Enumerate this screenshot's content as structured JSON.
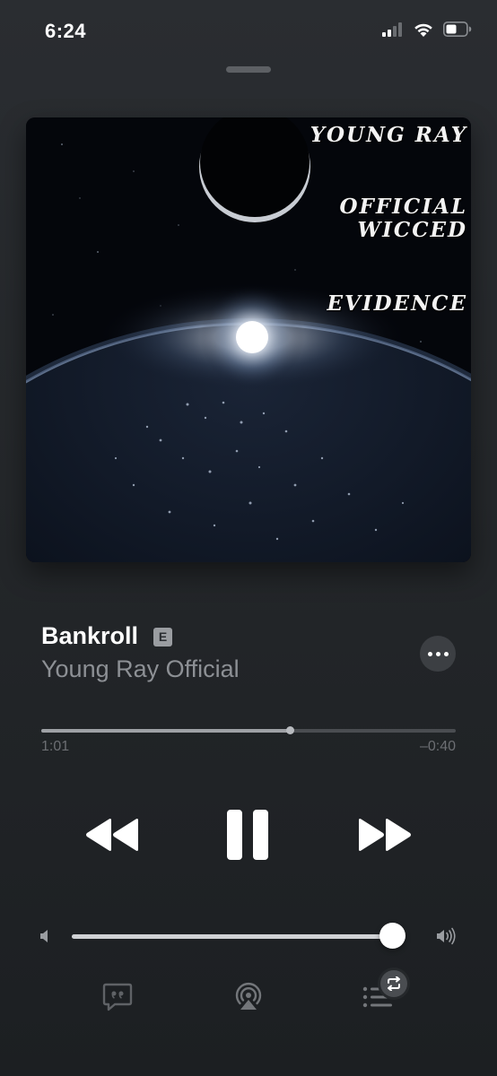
{
  "status_bar": {
    "time": "6:24"
  },
  "artwork": {
    "lines": [
      "YOUNG RAY",
      "OFFICIAL",
      "WICCED",
      "EVIDENCE"
    ]
  },
  "track": {
    "title": "Bankroll",
    "explicit_badge": "E",
    "artist": "Young Ray Official"
  },
  "playback": {
    "elapsed": "1:01",
    "remaining": "–0:40",
    "progress_fraction": 0.6,
    "state": "playing"
  },
  "volume": {
    "level_fraction": 0.96
  },
  "icons": {
    "cellular": "cellular-signal-icon",
    "wifi": "wifi-icon",
    "battery": "battery-icon",
    "more": "ellipsis-icon",
    "rewind": "rewind-icon",
    "pause": "pause-icon",
    "forward": "fast-forward-icon",
    "volume_low": "speaker-low-icon",
    "volume_high": "speaker-high-icon",
    "lyrics": "lyrics-quote-icon",
    "airplay": "airplay-icon",
    "queue": "queue-list-icon",
    "repeat": "repeat-icon"
  },
  "colors": {
    "background": "#24272a",
    "primary_text": "#ffffff",
    "secondary_text": "#8d9095",
    "accent": "#ffffff"
  }
}
